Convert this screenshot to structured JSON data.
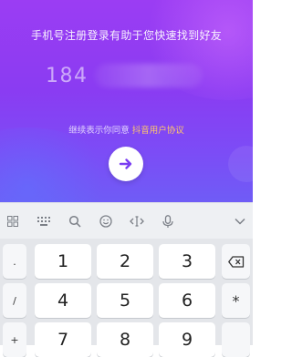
{
  "hero": {
    "subtitle": "手机号注册登录有助于您快速找到好友",
    "phone_value": "184",
    "agreement_prefix": "继续表示你同意",
    "agreement_link": "抖音用户协议"
  },
  "colors": {
    "gradient_top": "#9b3df3",
    "gradient_bottom": "#6f5cf6",
    "agreement_link": "#ffc76b",
    "next_arrow": "#7a3ef2",
    "keyboard_bg": "#e4e6ea"
  },
  "toolbar": {
    "icons": [
      "grid-icon",
      "keyboard-icon",
      "search-icon",
      "emoji-icon",
      "cursor-icon",
      "microphone-icon",
      "chevron-down-icon"
    ]
  },
  "keyboard": {
    "left_keys": [
      ".",
      "/",
      "+"
    ],
    "row1": [
      "1",
      "2",
      "3"
    ],
    "row2": [
      "4",
      "5",
      "6"
    ],
    "row3": [
      "7",
      "8",
      "9"
    ],
    "backspace_icon": "backspace-icon",
    "multiply": "*"
  }
}
